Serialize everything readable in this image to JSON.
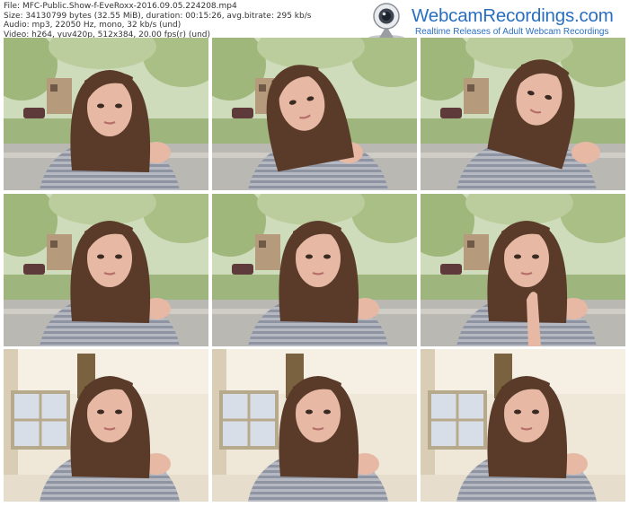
{
  "file_info": {
    "file": "File: MFC-Public.Show-f-EveRoxx-2016.09.05.224208.mp4",
    "size": "Size: 34130799 bytes (32.55 MiB), duration: 00:15:26, avg.bitrate: 295 kb/s",
    "audio": "Audio: mp3, 22050 Hz, mono, 32 kb/s (und)",
    "video": "Video: h264, yuv420p, 512x384, 20.00 fps(r) (und)"
  },
  "brand": {
    "name": "WebcamRecordings.com",
    "tagline": "Realtime Releases of Adult Webcam Recordings",
    "icon": "webcam-icon",
    "color": "#2a6fbf"
  },
  "thumbnails": [
    {
      "scene": "outdoor",
      "pose": "down"
    },
    {
      "scene": "outdoor",
      "pose": "side"
    },
    {
      "scene": "outdoor",
      "pose": "tilt"
    },
    {
      "scene": "outdoor",
      "pose": "front"
    },
    {
      "scene": "outdoor",
      "pose": "front"
    },
    {
      "scene": "outdoor",
      "pose": "hand"
    },
    {
      "scene": "indoor",
      "pose": "front"
    },
    {
      "scene": "indoor",
      "pose": "front"
    },
    {
      "scene": "indoor",
      "pose": "front"
    }
  ]
}
